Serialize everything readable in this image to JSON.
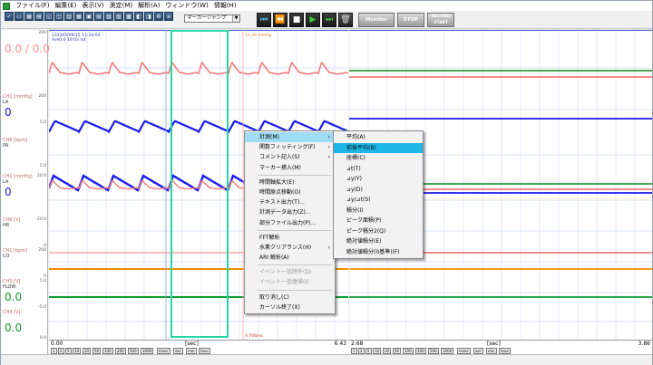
{
  "menubar": {
    "items": [
      "ファイル(F)",
      "編集(E)",
      "表示(V)",
      "測定(M)",
      "解析(A)",
      "ウィンドウ(W)",
      "情報(H)"
    ]
  },
  "toolbar": {
    "labels": [
      "保存",
      "印刷",
      "開く",
      "ウィンドウ",
      "拡大/縮小",
      "時間軸",
      "レポート",
      "グリッド",
      "区間",
      "解析"
    ],
    "jump_combo": "マーカージャンプ",
    "monitor_label": "Monitor",
    "stop_label": "STOP",
    "record_label": "RECORD START"
  },
  "channels": [
    {
      "head": "",
      "name": "",
      "big": "0.0 / 0.0",
      "big_color": "#ff8f8f",
      "scale_top": "200",
      "scale_bottom": ""
    },
    {
      "head": "CH1 [mmHg]",
      "name": "LA",
      "big": "0",
      "big_color": "#1a1aee",
      "scale_top": "200",
      "scale_bottom": "5.0"
    },
    {
      "head": "CH6 [bpm]",
      "name": "PA",
      "big": "",
      "big_color": "#1a1aee",
      "scale_top": "",
      "scale_bottom": "5.0"
    },
    {
      "head": "CH1 [mmHg]",
      "name": "LA",
      "big": "0",
      "big_color": "#1a1aee",
      "scale_top": "20.0",
      "scale_bottom": ""
    },
    {
      "head": "CH6 [V]",
      "name": "HR",
      "big": "",
      "big_color": "#1a1aee",
      "scale_top": "-20.0",
      "scale_bottom": "0"
    },
    {
      "head": "CH1 [bpm]",
      "name": "CO",
      "big": "",
      "big_color": "#e07b00",
      "scale_top": "200",
      "scale_bottom": "0"
    },
    {
      "head": "CH3 [V]",
      "name": "FLOW",
      "big": "0.0",
      "big_color": "#0a9a2a",
      "scale_top": "5.0",
      "scale_bottom": "-5.0"
    },
    {
      "head": "CH4 [V]",
      "name": "",
      "big": "0.0",
      "big_color": "#0a9a2a",
      "scale_top": "",
      "scale_bottom": "0.0"
    }
  ],
  "plot_left": {
    "header_text": "133305/09/15 11:24:04",
    "header_text2": "Ave0:0 10:03 ls4",
    "marker_label": "12.39 mmHg",
    "x_start": "0.00",
    "x_end": "6.43",
    "x_unit": "[sec]",
    "bottom_marker": "A:706ms"
  },
  "plot_right": {
    "x_start": "2.68",
    "x_end": "3.86",
    "x_unit": "[sec]"
  },
  "time_scale_units": [
    "1",
    "2",
    "5",
    "10",
    "20",
    "50",
    "100",
    "200",
    "500",
    "1000",
    "msec",
    "sec",
    "min",
    "hour"
  ],
  "context_menu": [
    {
      "label": "計測(M)",
      "submenu": true,
      "highlight": true,
      "disabled": false
    },
    {
      "label": "関数フィッティング(F)",
      "submenu": true,
      "highlight": false,
      "disabled": false
    },
    {
      "label": "コメント記入(S)",
      "submenu": true,
      "highlight": false,
      "disabled": false
    },
    {
      "label": "マーカー挿入(M)",
      "submenu": false,
      "highlight": false,
      "disabled": false
    },
    {
      "sep": true
    },
    {
      "label": "時間軸拡大(E)",
      "submenu": false,
      "highlight": false,
      "disabled": false
    },
    {
      "label": "時間原点移動(O)",
      "submenu": false,
      "highlight": false,
      "disabled": false
    },
    {
      "label": "テキスト出力(T)...",
      "submenu": false,
      "highlight": false,
      "disabled": false
    },
    {
      "label": "計測データ出力(Z)...",
      "submenu": false,
      "highlight": false,
      "disabled": false
    },
    {
      "label": "部分ファイル出力(P)...",
      "submenu": false,
      "highlight": false,
      "disabled": false
    },
    {
      "sep": true
    },
    {
      "label": "FFT解析",
      "submenu": false,
      "highlight": false,
      "disabled": false
    },
    {
      "label": "水素クリアランス(H)",
      "submenu": true,
      "highlight": false,
      "disabled": false
    },
    {
      "label": "ARI 解析(A)",
      "submenu": false,
      "highlight": false,
      "disabled": false
    },
    {
      "sep": true
    },
    {
      "label": "イベント一括除外(D)",
      "submenu": false,
      "highlight": false,
      "disabled": true
    },
    {
      "label": "イベント一括復帰(I)",
      "submenu": false,
      "highlight": false,
      "disabled": true
    },
    {
      "sep": true
    },
    {
      "label": "取り消し(C)",
      "submenu": false,
      "highlight": false,
      "disabled": false
    },
    {
      "label": "カーソル終了(X)",
      "submenu": false,
      "highlight": false,
      "disabled": false
    }
  ],
  "submenu": [
    {
      "label": "平均(A)",
      "highlight": false
    },
    {
      "label": "前後平均(B)",
      "highlight": true
    },
    {
      "label": "座標(C)",
      "highlight": false
    },
    {
      "label": "⊿t(T)",
      "highlight": false
    },
    {
      "label": "⊿y(Y)",
      "highlight": false
    },
    {
      "label": "⊿y(D)",
      "highlight": false
    },
    {
      "label": "⊿y/⊿t(S)",
      "highlight": false
    },
    {
      "label": "積分(I)",
      "highlight": false
    },
    {
      "label": "ピーク面積(P)",
      "highlight": false
    },
    {
      "label": "ピーク積分2(Q)",
      "highlight": false
    },
    {
      "label": "絶対値積分(E)",
      "highlight": false
    },
    {
      "label": "絶対値積分(0基準)(F)",
      "highlight": false
    }
  ],
  "colors": {
    "pink_trace": "#f47a7a",
    "blue_trace": "#1a1aee",
    "orange_trace": "#f08a00",
    "green_trace": "#0c9a30",
    "selection_box": "#26d6a6",
    "menu_highlight": "#1fb8e6"
  }
}
